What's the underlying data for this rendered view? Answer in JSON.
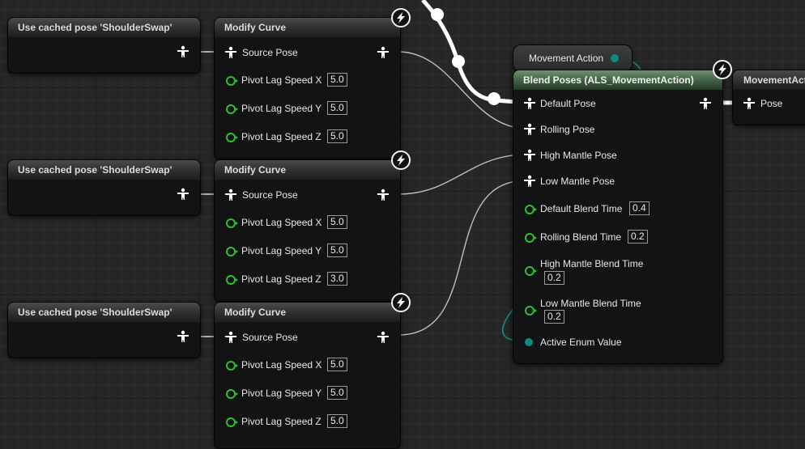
{
  "cached_nodes": [
    {
      "title": "Use cached pose 'ShoulderSwap'"
    },
    {
      "title": "Use cached pose 'ShoulderSwap'"
    },
    {
      "title": "Use cached pose 'ShoulderSwap'"
    }
  ],
  "modify_nodes": [
    {
      "title": "Modify Curve",
      "source_pose": "Source Pose",
      "x_label": "Pivot Lag Speed X",
      "x_value": "5.0",
      "y_label": "Pivot Lag Speed Y",
      "y_value": "5.0",
      "z_label": "Pivot Lag Speed Z",
      "z_value": "5.0"
    },
    {
      "title": "Modify Curve",
      "source_pose": "Source Pose",
      "x_label": "Pivot Lag Speed X",
      "x_value": "5.0",
      "y_label": "Pivot Lag Speed Y",
      "y_value": "5.0",
      "z_label": "Pivot Lag Speed Z",
      "z_value": "3.0"
    },
    {
      "title": "Modify Curve",
      "source_pose": "Source Pose",
      "x_label": "Pivot Lag Speed X",
      "x_value": "5.0",
      "y_label": "Pivot Lag Speed Y",
      "y_value": "5.0",
      "z_label": "Pivot Lag Speed Z",
      "z_value": "5.0"
    }
  ],
  "movement_action": {
    "label": "Movement Action"
  },
  "blend_node": {
    "title": "Blend Poses (ALS_MovementAction)",
    "default_pose": "Default Pose",
    "rolling_pose": "Rolling Pose",
    "high_mantle_pose": "High Mantle Pose",
    "low_mantle_pose": "Low Mantle Pose",
    "default_blend_time": "Default Blend Time",
    "default_blend_value": "0.4",
    "rolling_blend_time": "Rolling Blend Time",
    "rolling_blend_value": "0.2",
    "high_mantle_blend_time": "High Mantle Blend Time",
    "high_mantle_blend_value": "0.2",
    "low_mantle_blend_time": "Low Mantle Blend Time",
    "low_mantle_blend_value": "0.2",
    "active_enum_value": "Active Enum Value"
  },
  "output_node": {
    "title": "MovementAction",
    "pose": "Pose"
  },
  "colors": {
    "pose_pin": "#ffffff",
    "float_pin": "#2fbf2f",
    "enum_pin": "#0c8c7c",
    "exec_wire": "#ffffff"
  },
  "icons": {
    "pose": "pose-person-icon",
    "hot_reload": "lightning-bolt-icon"
  }
}
